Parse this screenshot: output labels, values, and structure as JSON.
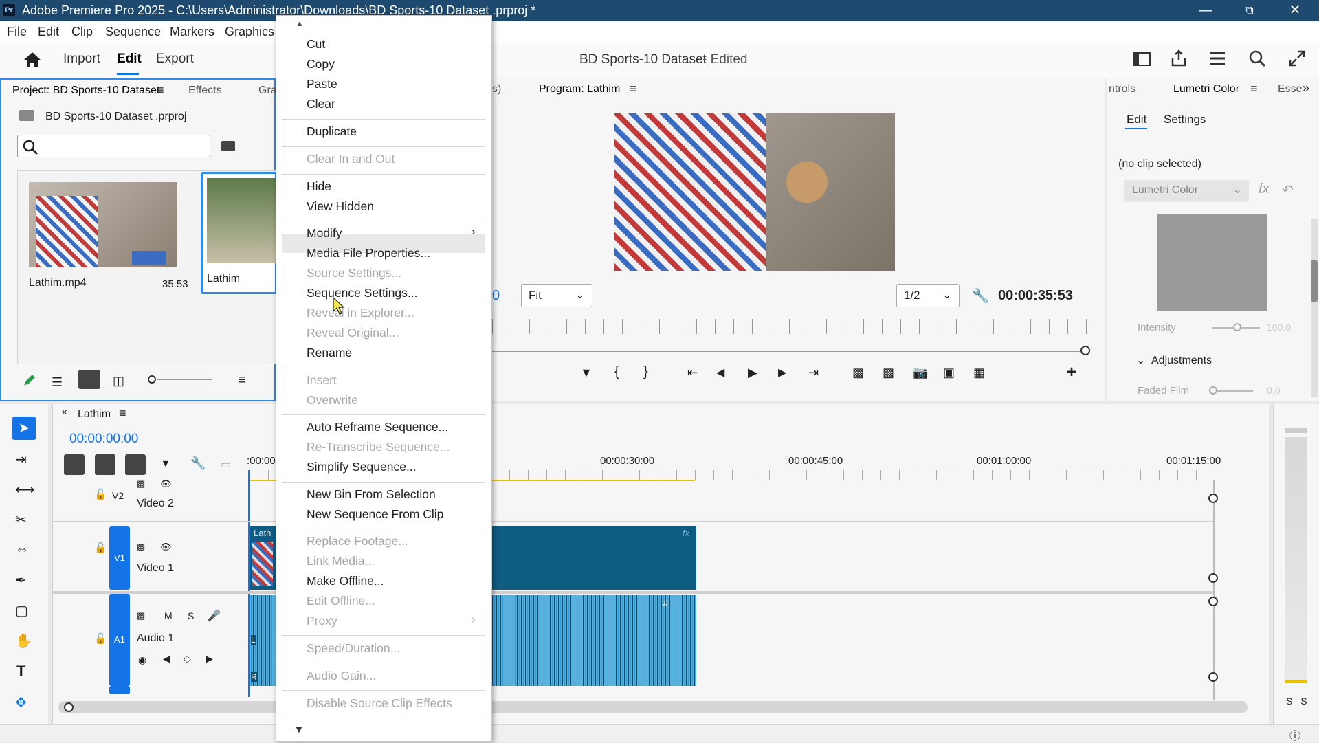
{
  "window": {
    "title": "Adobe Premiere Pro 2025 - C:\\Users\\Administrator\\Downloads\\BD Sports-10 Dataset .prproj *",
    "logo": "Pr"
  },
  "menubar": {
    "items": [
      "File",
      "Edit",
      "Clip",
      "Sequence",
      "Markers",
      "Graphics"
    ]
  },
  "toolbar": {
    "tabs": [
      "Import",
      "Edit",
      "Export"
    ],
    "active_tab": "Edit",
    "project_title": "BD Sports-10 Dataset",
    "project_status": "- Edited"
  },
  "project_panel": {
    "tab_label": "Project: BD Sports-10 Dataset",
    "effects_tab": "Effects",
    "graphics_tab": "Gra",
    "file_name": "BD Sports-10 Dataset .prproj",
    "items": [
      {
        "name": "Lathim.mp4",
        "duration": "35:53"
      },
      {
        "name": "Lathim",
        "duration": ""
      }
    ]
  },
  "program_monitor": {
    "tab_label": "Program: Lathim",
    "source_fragment": "s)",
    "fit": "Fit",
    "resolution": "1/2",
    "timecode": "00:00:35:53",
    "left_timecode_fragment": "0"
  },
  "lumetri": {
    "controls_tab": "ntrols",
    "tab_label": "Lumetri Color",
    "essentials_tab": "Esse",
    "edit_tab": "Edit",
    "settings_tab": "Settings",
    "no_clip": "(no clip selected)",
    "dropdown": "Lumetri Color",
    "intensity_label": "Intensity",
    "intensity_value": "100.0",
    "adjustments": "Adjustments",
    "faded_film_label": "Faded Film",
    "faded_film_value": "0.0"
  },
  "timeline": {
    "sequence_name": "Lathim",
    "timecode": "00:00:00:00",
    "ruler": [
      "00:00:30:00",
      "00:00:45:00",
      "00:01:00:00",
      "00:01:15:00"
    ],
    "ruler_start": ":00:00",
    "clip_label": "Lath",
    "tracks": [
      {
        "id": "V2",
        "name": "Video 2"
      },
      {
        "id": "V1",
        "name": "Video 1"
      },
      {
        "id": "A1",
        "name": "Audio 1"
      }
    ],
    "audio_m": "M",
    "audio_s": "S",
    "chan_l": "L",
    "chan_r": "R"
  },
  "meters": {
    "labels": "S S"
  },
  "context_menu": {
    "items": [
      {
        "label": "Cut",
        "disabled": false
      },
      {
        "label": "Copy",
        "disabled": false
      },
      {
        "label": "Paste",
        "disabled": false
      },
      {
        "label": "Clear",
        "disabled": false
      },
      {
        "label": "Duplicate",
        "disabled": false
      },
      {
        "label": "Clear In and Out",
        "disabled": true
      },
      {
        "label": "Hide",
        "disabled": false
      },
      {
        "label": "View Hidden",
        "disabled": false
      },
      {
        "label": "Modify",
        "disabled": false
      },
      {
        "label": "Media File Properties...",
        "disabled": false
      },
      {
        "label": "Source Settings...",
        "disabled": true
      },
      {
        "label": "Sequence Settings...",
        "disabled": false
      },
      {
        "label": "Reveal in Explorer...",
        "disabled": true
      },
      {
        "label": "Reveal Original...",
        "disabled": true
      },
      {
        "label": "Rename",
        "disabled": false
      },
      {
        "label": "Insert",
        "disabled": true
      },
      {
        "label": "Overwrite",
        "disabled": true
      },
      {
        "label": "Auto Reframe Sequence...",
        "disabled": false
      },
      {
        "label": "Re-Transcribe Sequence...",
        "disabled": true
      },
      {
        "label": "Simplify Sequence...",
        "disabled": false
      },
      {
        "label": "New Bin From Selection",
        "disabled": false
      },
      {
        "label": "New Sequence From Clip",
        "disabled": false
      },
      {
        "label": "Replace Footage...",
        "disabled": true
      },
      {
        "label": "Link Media...",
        "disabled": true
      },
      {
        "label": "Make Offline...",
        "disabled": false
      },
      {
        "label": "Edit Offline...",
        "disabled": true
      },
      {
        "label": "Proxy",
        "disabled": true
      },
      {
        "label": "Speed/Duration...",
        "disabled": true
      },
      {
        "label": "Audio Gain...",
        "disabled": true
      },
      {
        "label": "Disable Source Clip Effects",
        "disabled": true
      }
    ],
    "hovered": "Sequence Settings..."
  },
  "colors": {
    "titlebar": "#1e4a70",
    "accent": "#1473e6",
    "clip": "#0f5c83",
    "audio_wave": "#4fb3e8"
  }
}
